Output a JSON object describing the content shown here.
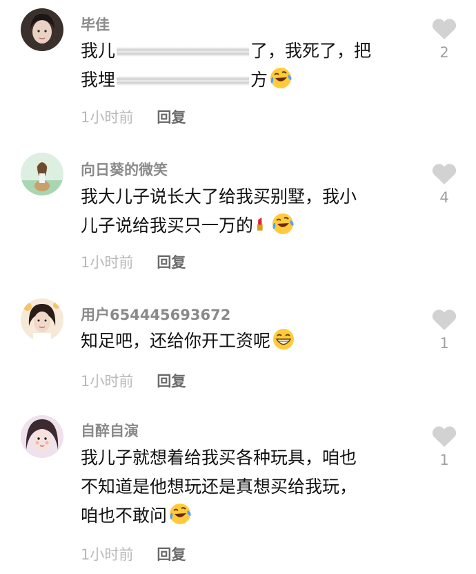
{
  "comments": [
    {
      "username": "毕佳",
      "lines": [
        {
          "before": "我儿",
          "after": "了，我死了，把"
        },
        {
          "before": "我埋",
          "after": "方"
        }
      ],
      "time": "1小时前",
      "reply": "回复",
      "likes": "2"
    },
    {
      "username": "向日葵的微笑",
      "lines": [
        "我大儿子说长大了给我买别墅，我小",
        "儿子说给我买只一万的"
      ],
      "time": "1小时前",
      "reply": "回复",
      "likes": "4"
    },
    {
      "username": "用户654445693672",
      "lines": [
        "知足吧，还给你开工资呢"
      ],
      "time": "1小时前",
      "reply": "回复",
      "likes": "1"
    },
    {
      "username": "自醉自演",
      "lines": [
        "我儿子就想着给我买各种玩具，咱也",
        "不知道是他想玩还是真想买给我玩，",
        "咱也不敢问"
      ],
      "time": "1小时前",
      "reply": "回复",
      "likes": "1"
    }
  ],
  "icons": {
    "like": "heart-icon",
    "emoji_laugh": "tears-of-joy-emoji",
    "emoji_grin": "grinning-emoji",
    "emoji_lipstick": "lipstick-emoji"
  },
  "colors": {
    "username": "#8a8a8a",
    "text": "#111111",
    "time": "#b8b8b8",
    "reply": "#6a6a6a",
    "heart": "#d2d2d2"
  }
}
